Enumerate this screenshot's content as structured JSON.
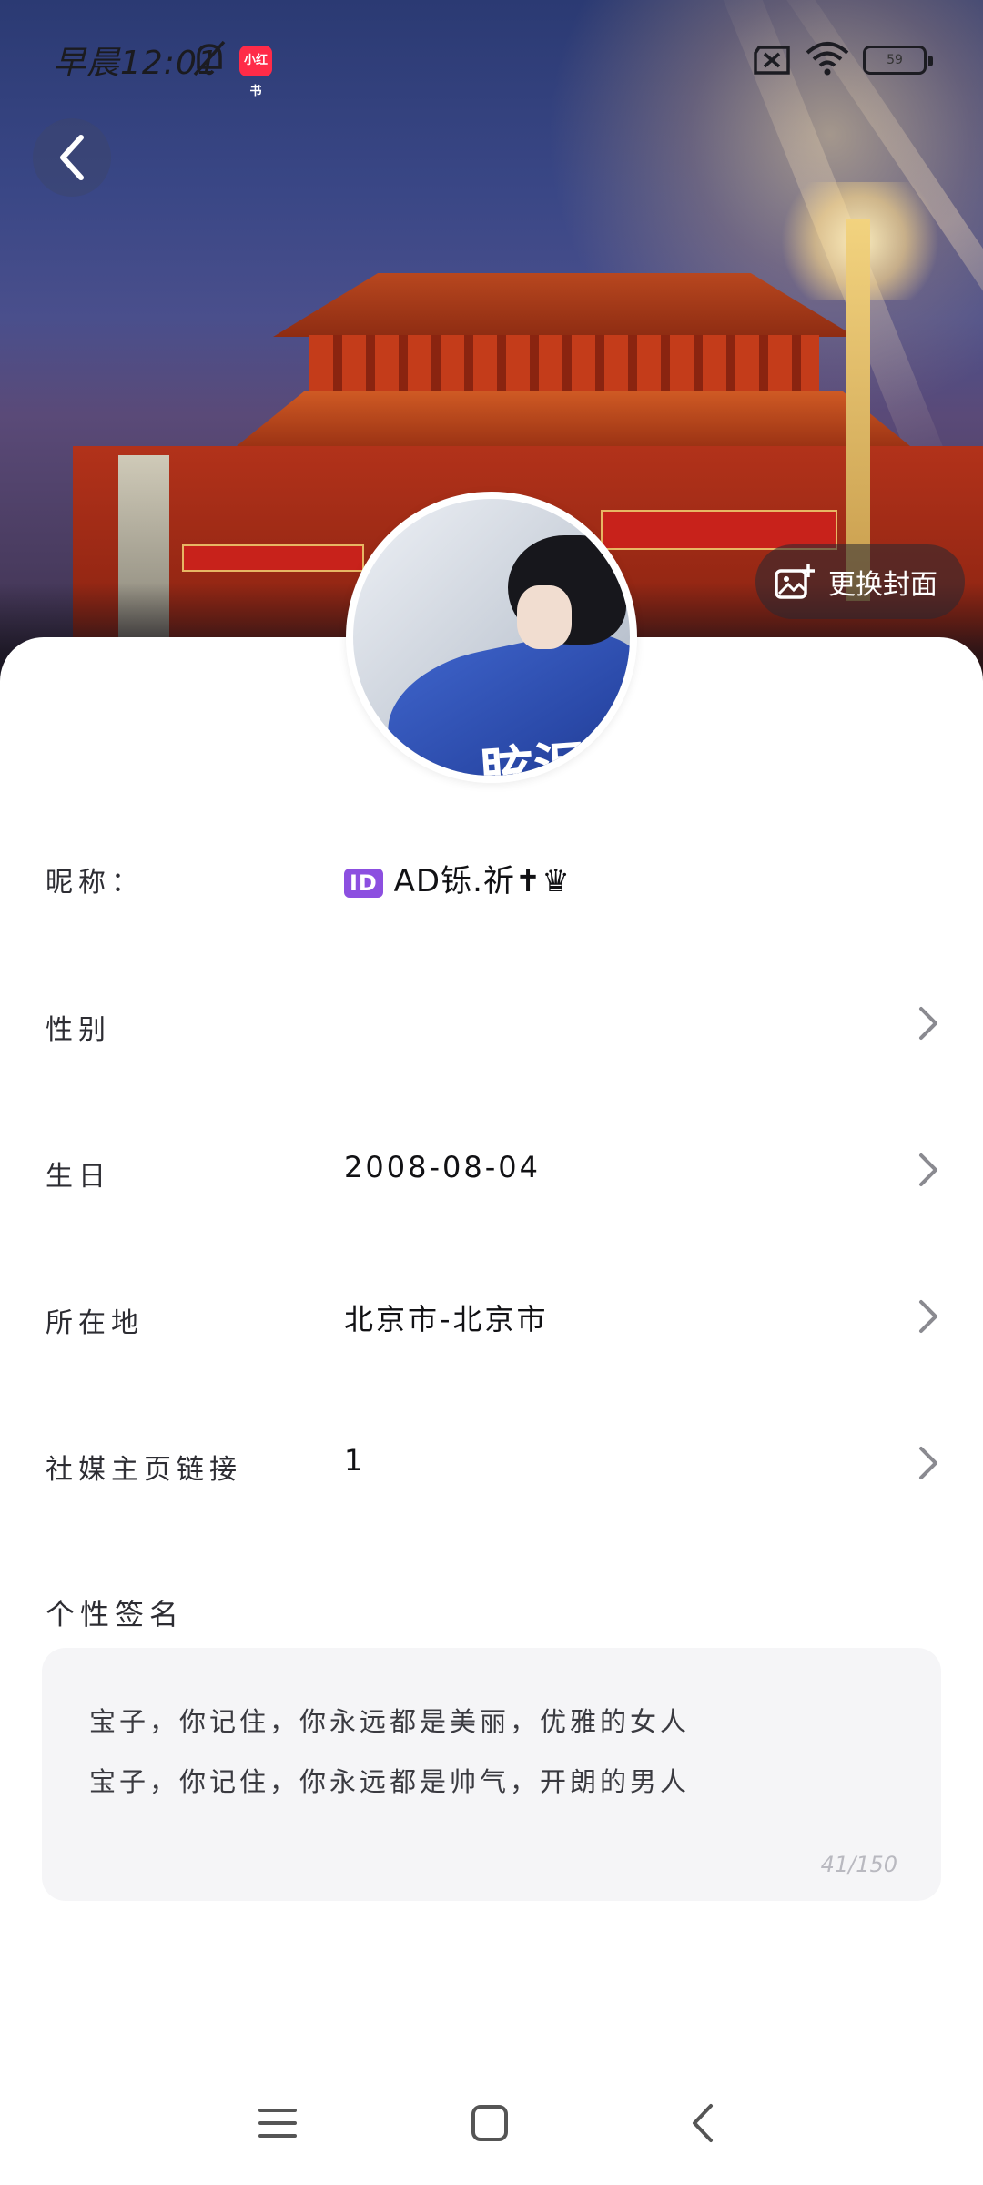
{
  "status_bar": {
    "time": "早晨12:01",
    "app_badge": "小红书",
    "battery": "59",
    "icons": [
      "bell-off-icon",
      "sim-x-icon",
      "wifi-icon",
      "battery-icon"
    ]
  },
  "header": {
    "back_icon": "chevron-left-icon",
    "change_cover_label": "更换封面",
    "change_cover_icon": "image-add-icon"
  },
  "avatar": {
    "shirt_text": "眩泪"
  },
  "profile": {
    "nickname_label": "昵称：",
    "nickname_value": "AD铄.祈✝♛",
    "nickname_badge": "ID",
    "gender_label": "性别",
    "gender_value": "",
    "birthday_label": "生日",
    "birthday_value": "2008-08-04",
    "location_label": "所在地",
    "location_value": "北京市-北京市",
    "social_label": "社媒主页链接",
    "social_value": "1"
  },
  "signature": {
    "title": "个性签名",
    "line1": "宝子，你记住，你永远都是美丽，优雅的女人",
    "line2": "宝子，你记住，你永远都是帅气，开朗的男人",
    "count": "41/150"
  },
  "nav_bar": {
    "icons": [
      "menu-icon",
      "home-icon",
      "back-icon"
    ]
  },
  "colors": {
    "accent_badge": "#ff2b48",
    "id_badge": "#8c4fe0",
    "signature_bg": "#f5f5f7"
  }
}
